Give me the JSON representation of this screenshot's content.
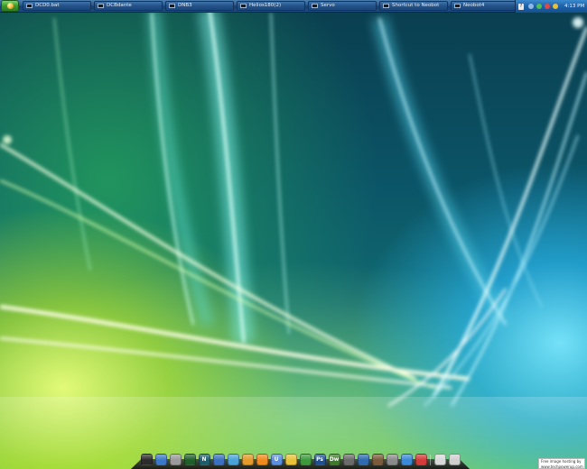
{
  "taskbar": {
    "start_label": "Start",
    "tasks": [
      {
        "label": "DCD0.bat"
      },
      {
        "label": "DCBdante"
      },
      {
        "label": "DNB3"
      },
      {
        "label": "Helios180(2)"
      },
      {
        "label": "Servo"
      },
      {
        "label": "Shortcut to Neobot"
      },
      {
        "label": "Neobot4"
      }
    ],
    "tray": {
      "help_glyph": "?",
      "clock": "4:13 PM"
    }
  },
  "dock": {
    "icons": [
      {
        "name": "activity-monitor-icon",
        "color": "#2b2b2b",
        "glyph": ""
      },
      {
        "name": "finder-icon",
        "color": "#3c78c8",
        "glyph": ""
      },
      {
        "name": "printer-icon",
        "color": "#9a9a9a",
        "glyph": ""
      },
      {
        "name": "terminal-icon",
        "color": "#1f5f2a",
        "glyph": ""
      },
      {
        "name": "netscape-icon",
        "color": "#1b5d6b",
        "glyph": "N"
      },
      {
        "name": "firefox-icon",
        "color": "#3a70c0",
        "glyph": ""
      },
      {
        "name": "messenger-icon",
        "color": "#49a3d8",
        "glyph": ""
      },
      {
        "name": "folder-icon",
        "color": "#e39a2a",
        "glyph": ""
      },
      {
        "name": "app-icon-orange",
        "color": "#f08a1c",
        "glyph": ""
      },
      {
        "name": "app-icon-blue-u",
        "color": "#5a8fe0",
        "glyph": "U"
      },
      {
        "name": "app-icon-globe",
        "color": "#e7c23a",
        "glyph": ""
      },
      {
        "name": "app-icon-green",
        "color": "#3c9a3c",
        "glyph": ""
      },
      {
        "name": "photoshop-icon",
        "color": "#1f4f8e",
        "glyph": "Ps"
      },
      {
        "name": "dreamweaver-icon",
        "color": "#3e7a2a",
        "glyph": "Dw"
      },
      {
        "name": "calculator-icon",
        "color": "#6a6a6a",
        "glyph": ""
      },
      {
        "name": "media-icon",
        "color": "#2d6ab0",
        "glyph": ""
      },
      {
        "name": "photo-icon",
        "color": "#7a5a3a",
        "glyph": ""
      },
      {
        "name": "settings-icon",
        "color": "#8a8a8a",
        "glyph": ""
      },
      {
        "name": "safari-icon",
        "color": "#3a88d8",
        "glyph": ""
      },
      {
        "name": "ical-icon",
        "color": "#d43a3a",
        "glyph": ""
      },
      {
        "name": "ipod-icon",
        "color": "#d8d8d8",
        "glyph": ""
      },
      {
        "name": "trash-icon",
        "color": "#cfcfcf",
        "glyph": ""
      }
    ]
  },
  "hosting_credit": {
    "line1": "Free image hosting by",
    "line2": "www.techpowerup.com"
  }
}
